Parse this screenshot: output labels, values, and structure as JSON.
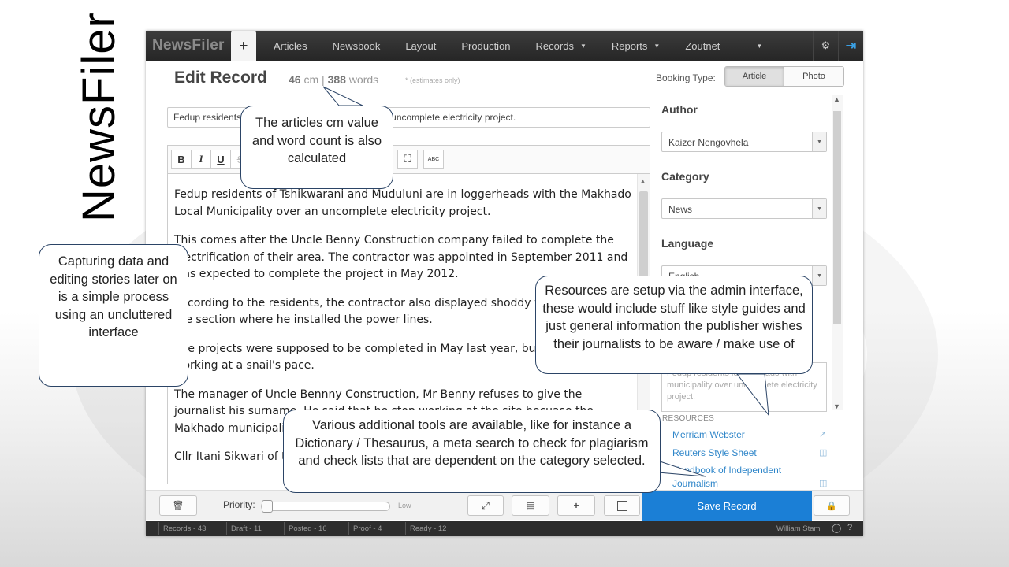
{
  "slide": {
    "title": "NewsFiler"
  },
  "nav": {
    "brand": "NewsFiler",
    "plus": "+",
    "items": [
      {
        "label": "Articles",
        "caret": false
      },
      {
        "label": "Newsbook",
        "caret": false
      },
      {
        "label": "Layout",
        "caret": false
      },
      {
        "label": "Production",
        "caret": false
      },
      {
        "label": "Records",
        "caret": true
      },
      {
        "label": "Reports",
        "caret": true
      }
    ],
    "zoutnet": "Zoutnet",
    "icons": [
      "settings-cog-icon",
      "logout-icon"
    ]
  },
  "header": {
    "title": "Edit Record",
    "cm_value": "46",
    "cm_unit": "cm",
    "separator": "|",
    "word_value": "388",
    "word_unit": "words",
    "estimate_note": "* (estimates only)",
    "booking_label": "Booking Type:",
    "booking_options": [
      "Article",
      "Photo"
    ],
    "booking_selected": "Article"
  },
  "article": {
    "headline": "Fedup residents loggerheads with municipality over uncomplete electricity project.",
    "toolbar": [
      "B",
      "I",
      "U",
      "S",
      "×",
      "↓",
      "↑",
      "⎘",
      "⎙",
      "⛶",
      "ABC"
    ],
    "paragraphs": [
      "Fedup residents of Tshikwarani and Muduluni are in loggerheads with the Makhado Local Municipality over an uncomplete electricity project.",
      "This comes after the Uncle Benny Construction company failed to complete the electrification of their area. The contractor was appointed in September 2011 and was expected to complete the project in May 2012.",
      "According to the residents, the contractor also displayed shoddy workmanship at the section where he installed the power lines.",
      "The projects were supposed to be completed in May last year, but he is still working at a snail's pace.",
      "The manager of Uncle Bennny Construction, Mr Benny refuses to give the journalist his surname. He said that he stop working at the site becuase the Makhado municipality still owe him payment.",
      "Cllr Itani Sikwari of the Department of Energy Affairs said that the municipality is"
    ]
  },
  "sidebar": {
    "author_label": "Author",
    "author_value": "Kaizer Nengovhela",
    "category_label": "Category",
    "category_value": "News",
    "language_label": "Language",
    "language_value": "English",
    "summary_text": "Fedup residents loggerheads with municipality over uncomplete electricity project.",
    "resources_label": "RESOURCES",
    "resources": [
      {
        "label": "Merriam Webster",
        "icon": "external-link-icon"
      },
      {
        "label": "Reuters Style Sheet",
        "icon": "file-icon"
      },
      {
        "label": "Handbook of Independent Journalism",
        "icon": "file-icon"
      }
    ],
    "tools": [
      "checklist-icon",
      "search-icon",
      "check-box-icon"
    ]
  },
  "actions": {
    "priority_label": "Priority:",
    "priority_level_label": "Low",
    "priority_value": 0,
    "save_label": "Save Record"
  },
  "status": {
    "records": "Records - 43",
    "draft": "Draft - 11",
    "posted": "Posted - 16",
    "proof": "Proof - 4",
    "ready": "Ready - 12",
    "user": "William Stam"
  },
  "callouts": {
    "cm": "The articles cm value and word count is also calculated",
    "capture": "Capturing data and editing stories later on is a simple process using an uncluttered interface",
    "resources": "Resources are setup via the admin interface, these would include stuff like style guides and just general information the publisher wishes their journalists to be aware / make use of",
    "tools": "Various additional tools are available, like for instance a Dictionary / Thesaurus, a meta search to check for plagiarism and check lists that are dependent on the category selected."
  },
  "colors": {
    "accent": "#1b7fd6",
    "link": "#2f86c9",
    "navbar": "#2b2b2b",
    "callout_border": "#2b4466"
  }
}
